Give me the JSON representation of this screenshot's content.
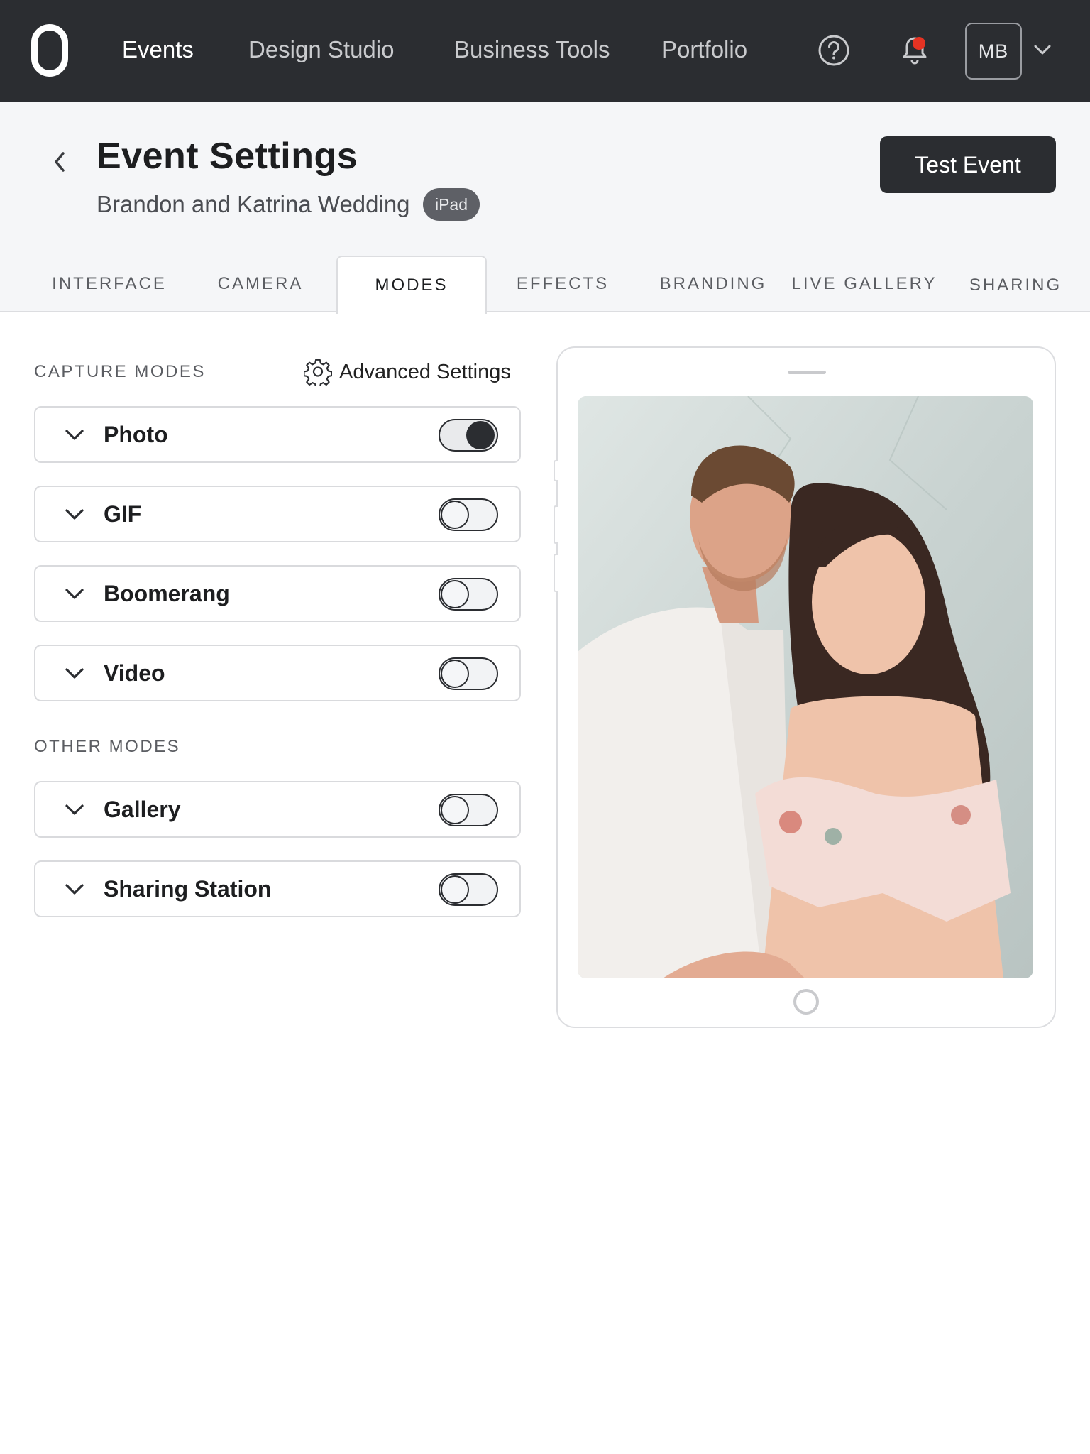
{
  "nav": {
    "logo": "0",
    "links": [
      "Events",
      "Design Studio",
      "Business Tools",
      "Portfolio"
    ],
    "active": "Events",
    "icons": [
      "help-circle-icon",
      "bell-icon"
    ],
    "avatar": "MB",
    "colors": {
      "bar": "#2b2d31",
      "notification": "#e53323"
    }
  },
  "header": {
    "title": "Event Settings",
    "subtitle": "Brandon and Katrina Wedding",
    "badge": "iPad",
    "test_button": "Test Event"
  },
  "tabs": [
    {
      "label": "INTERFACE",
      "active": false
    },
    {
      "label": "CAMERA",
      "active": false
    },
    {
      "label": "MODES",
      "active": true
    },
    {
      "label": "EFFECTS",
      "active": false
    },
    {
      "label": "BRANDING",
      "active": false
    },
    {
      "label": "LIVE GALLERY",
      "active": false
    },
    {
      "label": "SHARING",
      "active": false
    }
  ],
  "capture": {
    "label": "CAPTURE MODES",
    "advanced": "Advanced Settings",
    "modes": [
      {
        "label": "Photo",
        "enabled": true
      },
      {
        "label": "GIF",
        "enabled": false
      },
      {
        "label": "Boomerang",
        "enabled": false
      },
      {
        "label": "Video",
        "enabled": false
      }
    ]
  },
  "other": {
    "label": "OTHER MODES",
    "modes": [
      {
        "label": "Gallery",
        "enabled": false
      },
      {
        "label": "Sharing Station",
        "enabled": false
      }
    ]
  }
}
